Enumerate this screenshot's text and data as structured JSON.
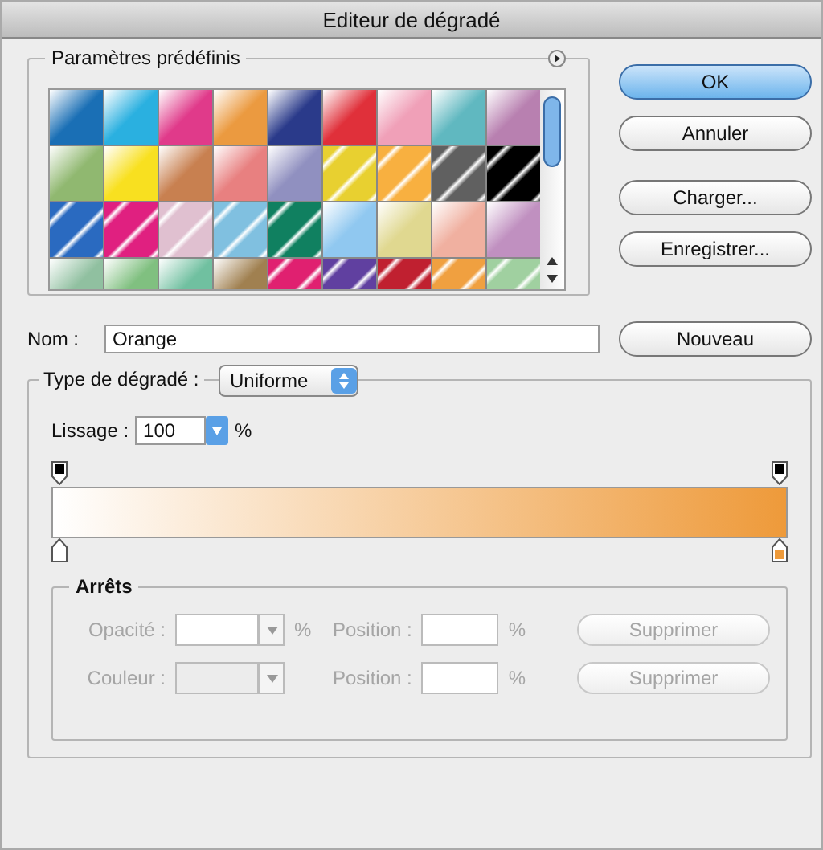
{
  "window": {
    "title": "Editeur de dégradé"
  },
  "presets": {
    "title": "Paramètres prédéfinis",
    "swatches": [
      {
        "kind": "plain",
        "color": "#1a6fb5"
      },
      {
        "kind": "plain",
        "color": "#2ab0e0"
      },
      {
        "kind": "plain",
        "color": "#e03a8a"
      },
      {
        "kind": "plain",
        "color": "#eb9a40"
      },
      {
        "kind": "plain",
        "color": "#2a3a8a"
      },
      {
        "kind": "plain",
        "color": "#e0303a"
      },
      {
        "kind": "plain",
        "color": "#f0a0b8"
      },
      {
        "kind": "plain",
        "color": "#60b8c0"
      },
      {
        "kind": "plain",
        "color": "#b880b0"
      },
      {
        "kind": "plain",
        "color": "#90b870"
      },
      {
        "kind": "plain",
        "color": "#f8e020"
      },
      {
        "kind": "plain",
        "color": "#c88050"
      },
      {
        "kind": "plain",
        "color": "#e88080"
      },
      {
        "kind": "plain",
        "color": "#9090c0"
      },
      {
        "kind": "stripes",
        "color": "#e8d030"
      },
      {
        "kind": "stripes",
        "color": "#f8b040"
      },
      {
        "kind": "stripes",
        "color": "#606060"
      },
      {
        "kind": "stripes",
        "color": "#000000"
      },
      {
        "kind": "stripes",
        "color": "#2a6ac0"
      },
      {
        "kind": "stripes",
        "color": "#e02080"
      },
      {
        "kind": "stripes",
        "color": "#e0c0d0"
      },
      {
        "kind": "stripes",
        "color": "#80c0e0"
      },
      {
        "kind": "stripes",
        "color": "#108060"
      },
      {
        "kind": "plain",
        "color": "#90c8f0"
      },
      {
        "kind": "plain",
        "color": "#e0d890"
      },
      {
        "kind": "plain",
        "color": "#f0b0a0"
      },
      {
        "kind": "plain",
        "color": "#c090c0"
      },
      {
        "kind": "plain",
        "color": "#90c0a0"
      },
      {
        "kind": "plain",
        "color": "#80c080"
      },
      {
        "kind": "plain",
        "color": "#70c0a0"
      },
      {
        "kind": "plain",
        "color": "#a08050"
      },
      {
        "kind": "stripes",
        "color": "#e02070"
      },
      {
        "kind": "stripes",
        "color": "#6040a0"
      },
      {
        "kind": "stripes",
        "color": "#c02030"
      },
      {
        "kind": "stripes",
        "color": "#f0a040"
      },
      {
        "kind": "stripes",
        "color": "#a0d0a0"
      }
    ]
  },
  "buttons": [
    {
      "label": "OK",
      "default": true
    },
    {
      "label": "Annuler",
      "default": false
    },
    {
      "label": "Charger..."
    },
    {
      "label": "Enregistrer..."
    }
  ],
  "name": {
    "label": "Nom :",
    "value": "Orange",
    "button": "Nouveau"
  },
  "gradient": {
    "type_label": "Type de dégradé :",
    "type_value": "Uniforme",
    "smoothing_label": "Lissage :",
    "smoothing_value": "100",
    "smoothing_unit": "%",
    "opacity_stops": [
      {
        "color": "#000000"
      },
      {
        "color": "#000000"
      }
    ],
    "color_stops": [
      {
        "color": "#ffffff"
      },
      {
        "color": "#ee9a3a"
      }
    ]
  },
  "stops": {
    "title": "Arrêts",
    "disabled": true,
    "rows": [
      {
        "label": "Opacité :",
        "unit": "%",
        "position_label": "Position :",
        "position_unit": "%",
        "button": "Supprimer"
      },
      {
        "label": "Couleur :",
        "position_label": "Position :",
        "position_unit": "%",
        "button": "Supprimer"
      }
    ]
  }
}
